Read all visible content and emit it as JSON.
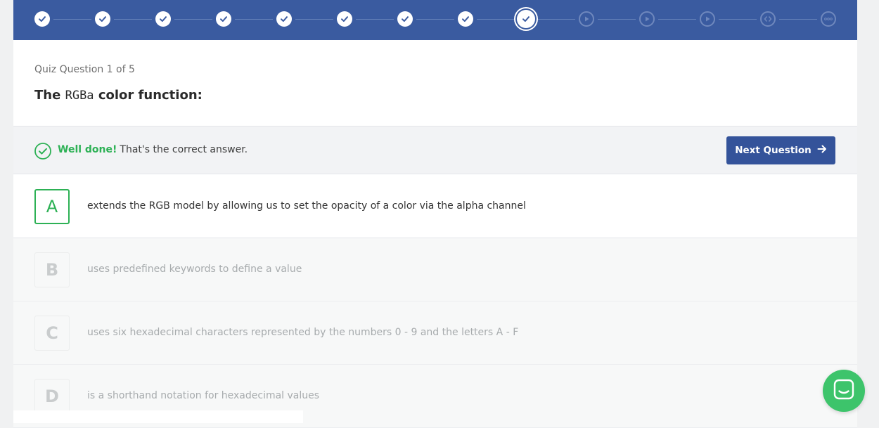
{
  "progress": {
    "steps": [
      {
        "state": "done",
        "icon": "check-icon"
      },
      {
        "state": "done",
        "icon": "check-icon"
      },
      {
        "state": "done",
        "icon": "check-icon"
      },
      {
        "state": "done",
        "icon": "check-icon"
      },
      {
        "state": "done",
        "icon": "check-icon"
      },
      {
        "state": "done",
        "icon": "check-icon"
      },
      {
        "state": "done",
        "icon": "check-icon"
      },
      {
        "state": "done",
        "icon": "check-icon"
      },
      {
        "state": "current",
        "icon": "check-icon"
      },
      {
        "state": "todo",
        "icon": "play-icon"
      },
      {
        "state": "todo",
        "icon": "play-icon"
      },
      {
        "state": "todo",
        "icon": "play-icon"
      },
      {
        "state": "todo",
        "icon": "code-icon"
      },
      {
        "state": "todo",
        "icon": "more-icon"
      }
    ],
    "colors": {
      "bar": "#3a5ba0",
      "done": "#ffffff",
      "todo": "#6f88bd"
    }
  },
  "quiz": {
    "counter": "Quiz Question 1 of 5",
    "question_prefix": "The",
    "question_code": "RGBa",
    "question_suffix": "color function:"
  },
  "feedback": {
    "strong": "Well done!",
    "message": "That's the correct answer.",
    "icon": "check-circle-icon",
    "color": "#2db155"
  },
  "next_button": {
    "label": "Next Question",
    "icon": "arrow-right-icon",
    "color": "#34539a"
  },
  "answers": [
    {
      "letter": "A",
      "text": "extends the RGB model by allowing us to set the opacity of a color via the alpha channel",
      "state": "correct"
    },
    {
      "letter": "B",
      "text": "uses predefined keywords to define a value",
      "state": "dim"
    },
    {
      "letter": "C",
      "text": "uses six hexadecimal characters represented by the numbers 0 - 9 and the letters A - F",
      "state": "dim"
    },
    {
      "letter": "D",
      "text": "is a shorthand notation for hexadecimal values",
      "state": "dim"
    }
  ],
  "chat": {
    "icon": "chat-icon",
    "color": "#3dc46b"
  }
}
